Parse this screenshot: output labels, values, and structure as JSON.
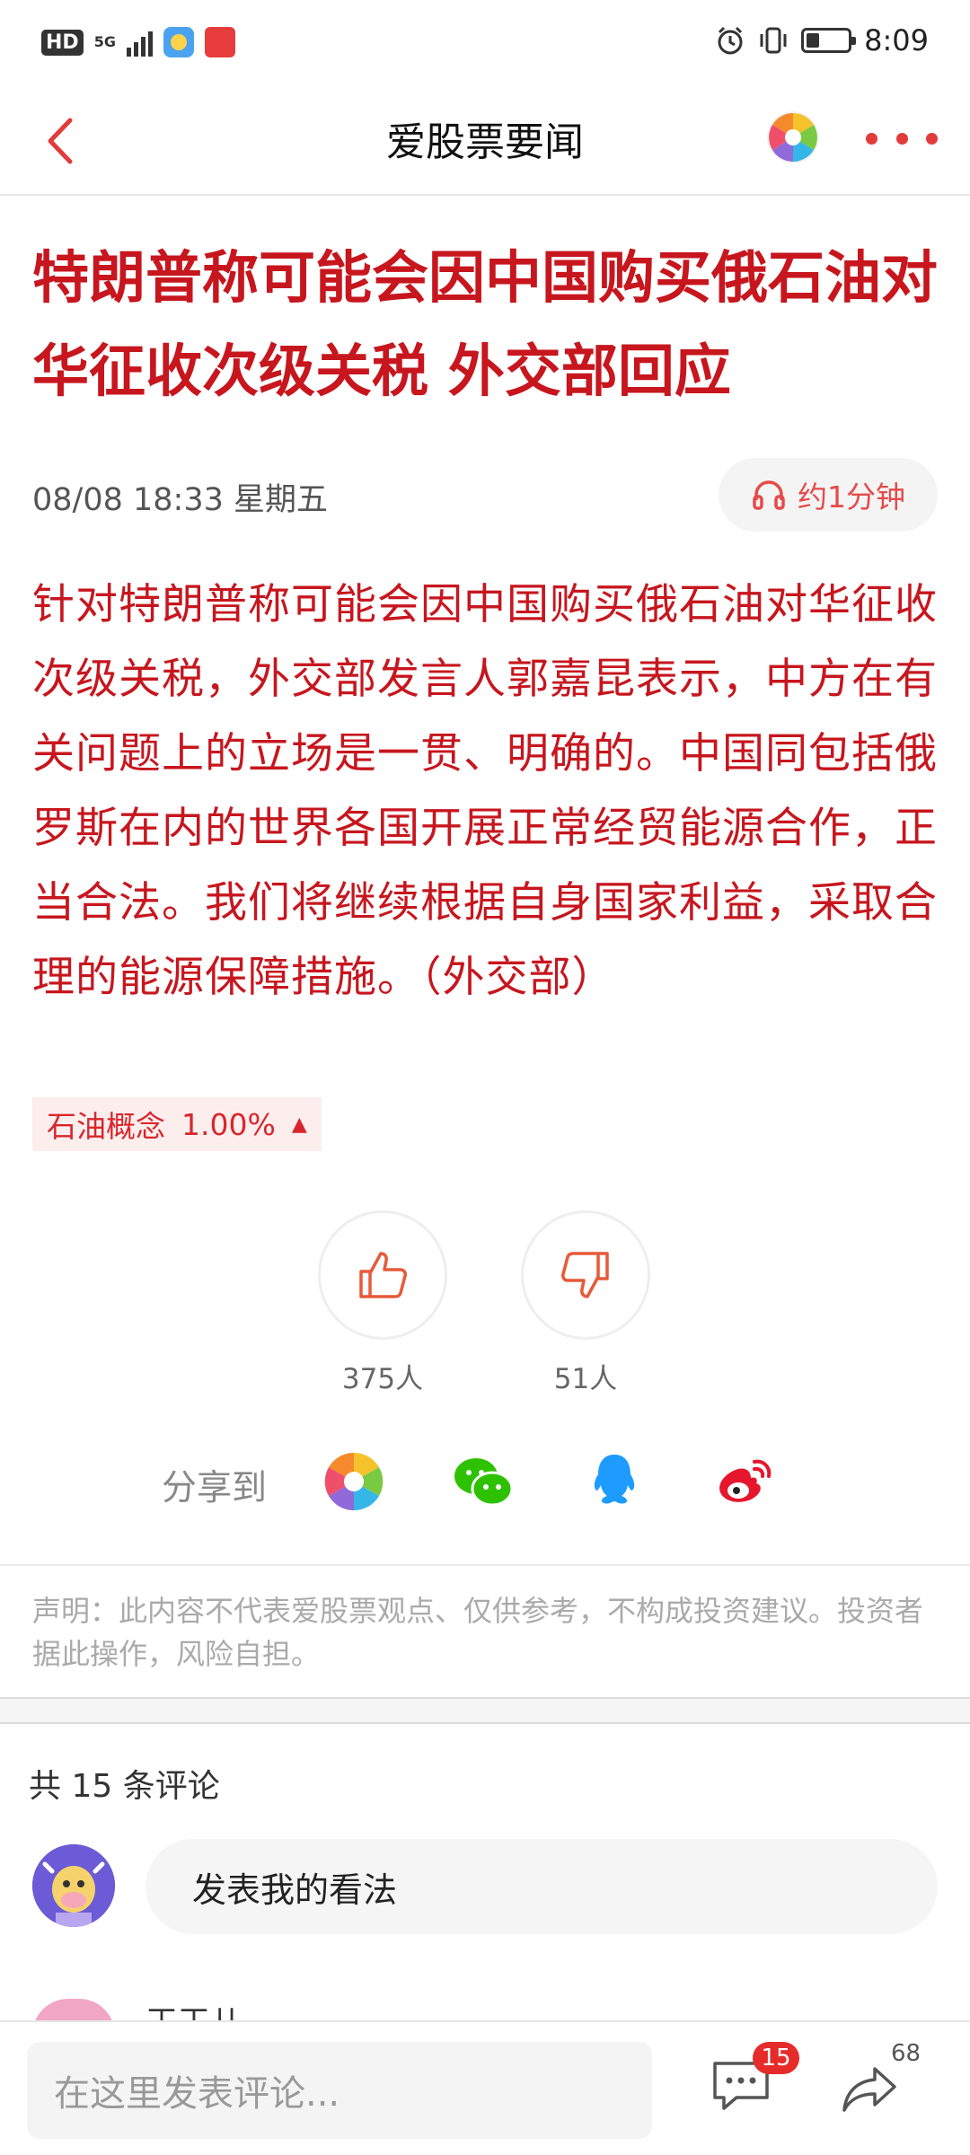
{
  "status_bar": {
    "hd": "HD",
    "network": "5G",
    "time": "8:09"
  },
  "nav": {
    "title": "爱股票要闻"
  },
  "article": {
    "headline": "特朗普称可能会因中国购买俄石油对华征收次级关税 外交部回应",
    "date": "08/08 18:33 星期五",
    "listen_label": "约1分钟",
    "body": "针对特朗普称可能会因中国购买俄石油对华征收次级关税，外交部发言人郭嘉昆表示，中方在有关问题上的立场是一贯、明确的。中国同包括俄罗斯在内的世界各国开展正常经贸能源合作，正当合法。我们将继续根据自身国家利益，采取合理的能源保障措施。（外交部）",
    "stock_tag": {
      "name": "石油概念",
      "change": "1.00%",
      "direction_symbol": "▲"
    }
  },
  "reactions": {
    "like_count": "375人",
    "dislike_count": "51人"
  },
  "share": {
    "label": "分享到"
  },
  "disclaimer": "声明：此内容不代表爱股票观点、仅供参考，不构成投资建议。投资者据此操作，风险自担。",
  "comments": {
    "count_label": "共 15 条评论",
    "opinion_placeholder": "发表我的看法",
    "first_commenter": "王王儿"
  },
  "bottom_bar": {
    "input_placeholder": "在这里发表评论...",
    "comment_badge": "15",
    "share_count": "68"
  },
  "colors": {
    "accent_red": "#c7161e",
    "tag_bg": "#fdeeee",
    "badge_red": "#e62b2b"
  }
}
